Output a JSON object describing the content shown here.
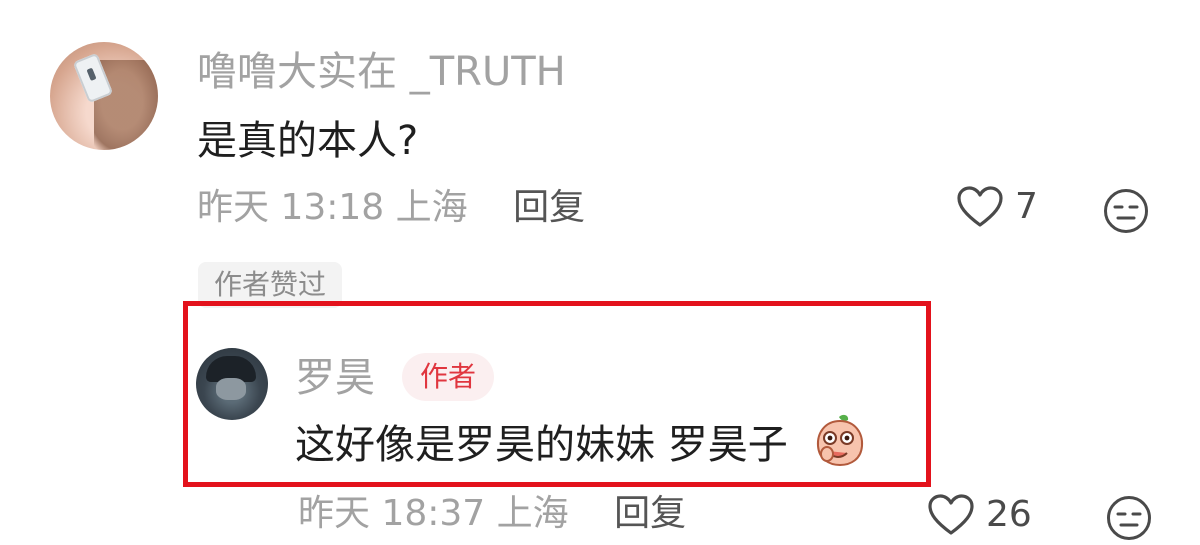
{
  "comment": {
    "username": "噜噜大实在 _TRUTH",
    "text": "是真的本人?",
    "time_location": "昨天 13:18 上海",
    "reply_label": "回复",
    "like_count": "7",
    "author_liked_badge": "作者赞过"
  },
  "reply": {
    "username": "罗昊",
    "author_badge": "作者",
    "text": "这好像是罗昊的妹妹 罗昊子",
    "emoji": "peach-face-emoji",
    "time_location": "昨天 18:37 上海",
    "reply_label": "回复",
    "like_count": "26"
  },
  "colors": {
    "highlight_border": "#e3121c",
    "author_badge_text": "#e0363f",
    "author_badge_bg": "#fbeff0",
    "muted_text": "#a2a2a2"
  },
  "icons": [
    "heart-outline-icon",
    "neutral-face-icon"
  ]
}
